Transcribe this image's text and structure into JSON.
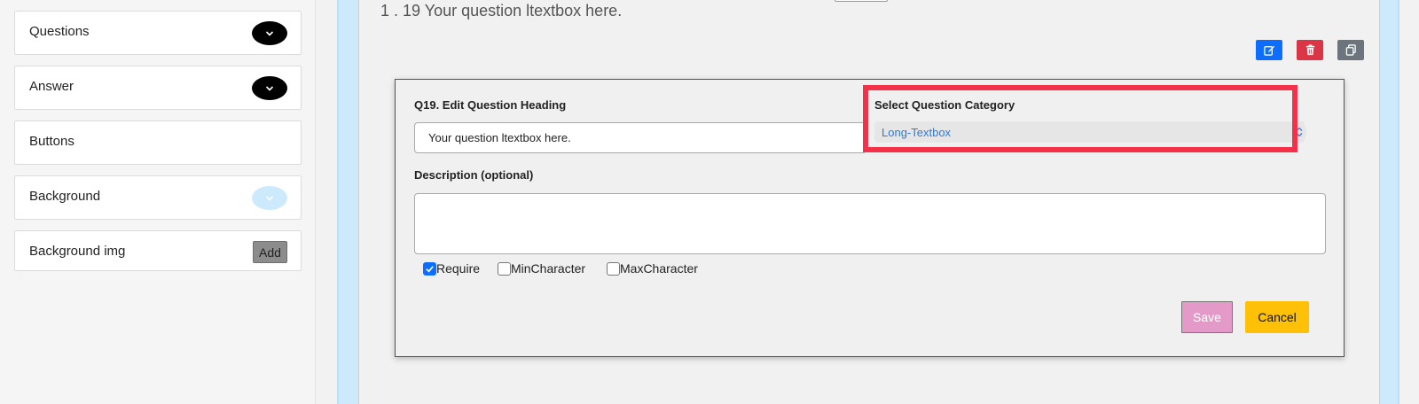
{
  "sidebar": {
    "items": [
      {
        "label": "Questions"
      },
      {
        "label": "Answer"
      },
      {
        "label": "Buttons"
      },
      {
        "label": "Background"
      },
      {
        "label": "Background img",
        "button": "Add"
      }
    ]
  },
  "question": {
    "title": "1 . 19 Your question ltextbox here."
  },
  "editor": {
    "heading_label": "Q19. Edit Question Heading",
    "heading_value": "Your question ltextbox here.",
    "category_label": "Select Question Category",
    "category_value": "Long-Textbox",
    "description_label": "Description (optional)",
    "description_value": "",
    "checkboxes": [
      {
        "label": "Require",
        "checked": true
      },
      {
        "label": "MinCharacter",
        "checked": false
      },
      {
        "label": "MaxCharacter",
        "checked": false
      }
    ],
    "save_label": "Save",
    "cancel_label": "Cancel"
  },
  "colors": {
    "accent": "#0d6efd",
    "danger": "#dc3545",
    "highlight": "#f5314a",
    "save": "#e49ac9",
    "cancel": "#ffc107"
  }
}
